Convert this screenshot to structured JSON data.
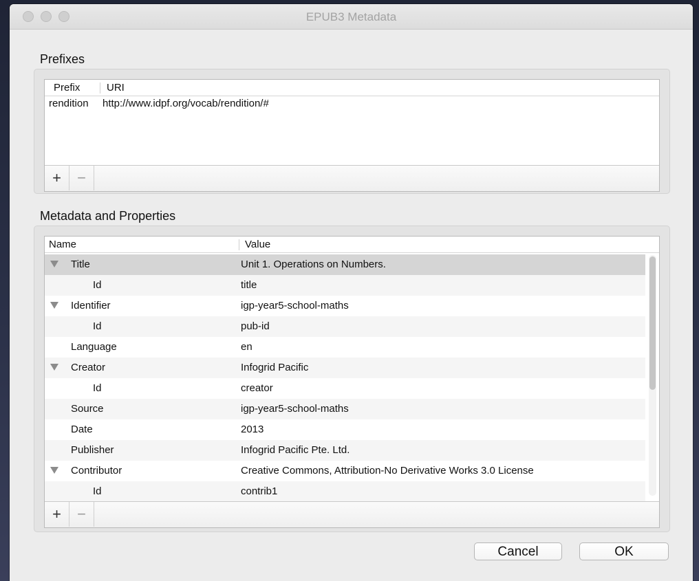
{
  "window": {
    "title": "EPUB3 Metadata"
  },
  "prefixes": {
    "section_title": "Prefixes",
    "columns": [
      "Prefix",
      "URI"
    ],
    "rows": [
      {
        "prefix": "rendition",
        "uri": "http://www.idpf.org/vocab/rendition/#"
      }
    ],
    "add_label": "+",
    "remove_label": "−"
  },
  "metadata": {
    "section_title": "Metadata and Properties",
    "columns": [
      "Name",
      "Value"
    ],
    "rows": [
      {
        "name": "Title",
        "value": "Unit 1. Operations on Numbers.",
        "level": 0,
        "expanded": true,
        "selected": true
      },
      {
        "name": "Id",
        "value": "title",
        "level": 1
      },
      {
        "name": "Identifier",
        "value": "igp-year5-school-maths",
        "level": 0,
        "expanded": true
      },
      {
        "name": "Id",
        "value": "pub-id",
        "level": 1
      },
      {
        "name": "Language",
        "value": "en",
        "level": 0
      },
      {
        "name": "Creator",
        "value": "Infogrid Pacific",
        "level": 0,
        "expanded": true
      },
      {
        "name": "Id",
        "value": "creator",
        "level": 1
      },
      {
        "name": "Source",
        "value": "igp-year5-school-maths",
        "level": 0
      },
      {
        "name": "Date",
        "value": "2013",
        "level": 0
      },
      {
        "name": "Publisher",
        "value": "Infogrid Pacific Pte. Ltd.",
        "level": 0
      },
      {
        "name": "Contributor",
        "value": "Creative Commons, Attribution-No Derivative Works 3.0 License",
        "level": 0,
        "expanded": true
      },
      {
        "name": "Id",
        "value": "contrib1",
        "level": 1
      }
    ],
    "add_label": "+",
    "remove_label": "−"
  },
  "buttons": {
    "cancel": "Cancel",
    "ok": "OK"
  },
  "colors": {
    "selected_row": "#d5d5d5",
    "alt_row": "#f5f5f5",
    "window_bg": "#ececec"
  }
}
